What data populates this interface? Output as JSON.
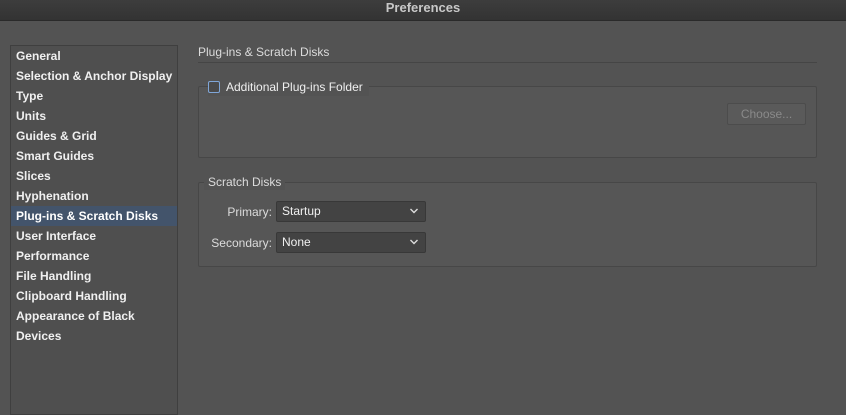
{
  "window": {
    "title": "Preferences"
  },
  "sidebar": {
    "items": [
      {
        "label": "General"
      },
      {
        "label": "Selection & Anchor Display"
      },
      {
        "label": "Type"
      },
      {
        "label": "Units"
      },
      {
        "label": "Guides & Grid"
      },
      {
        "label": "Smart Guides"
      },
      {
        "label": "Slices"
      },
      {
        "label": "Hyphenation"
      },
      {
        "label": "Plug-ins & Scratch Disks",
        "selected": true
      },
      {
        "label": "User Interface"
      },
      {
        "label": "Performance"
      },
      {
        "label": "File Handling"
      },
      {
        "label": "Clipboard Handling"
      },
      {
        "label": "Appearance of Black"
      },
      {
        "label": "Devices"
      }
    ]
  },
  "main": {
    "section_title": "Plug-ins & Scratch Disks",
    "plugins": {
      "checkbox_label": "Additional Plug-ins Folder",
      "checked": false,
      "choose_label": "Choose..."
    },
    "scratch": {
      "legend": "Scratch Disks",
      "primary_label": "Primary:",
      "primary_value": "Startup",
      "secondary_label": "Secondary:",
      "secondary_value": "None"
    }
  },
  "colors": {
    "background": "#535353",
    "selection": "#43546b",
    "checkbox_border": "#7fa6d8"
  }
}
